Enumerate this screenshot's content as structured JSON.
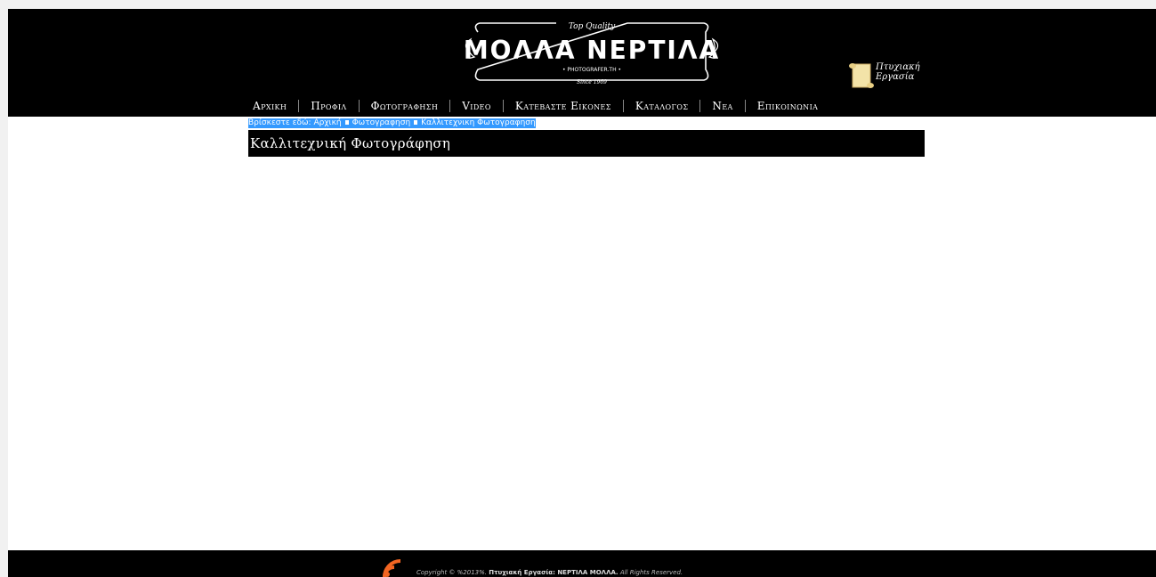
{
  "logo": {
    "top_line": "Top Quality",
    "name": "ΜΟΛΛΑ ΝΕΡΤΙΛΑ",
    "subtitle": "• PHOTOGRAFER.TH •",
    "since": "Since 1969"
  },
  "thesis": {
    "line1": "Πτυχιακή",
    "line2": "Εργασία"
  },
  "nav": [
    "Αρχικη",
    "Προφιλ",
    "Φωτογραφηση",
    "Video",
    "Κατεβαστε Εικονες",
    "Καταλογος",
    "Νεα",
    "Επικοινωνια"
  ],
  "breadcrumb": {
    "prefix": "Βρίσκεστε εδώ:",
    "items": [
      "Αρχική",
      "Φωτογραφηση",
      "Καλλιτεχνικη Φωτογραφηση"
    ]
  },
  "page_title": "Καλλιτεχνική Φωτογράφηση",
  "footer": {
    "copyright_prefix": "Copyright © %2013%.",
    "owner": "Πτυχιακή Εργασία: ΝΕΡΤΙΛΑ ΜΟΛΛΑ.",
    "rights": "All Rights Reserved."
  },
  "colors": {
    "header_bg": "#000000",
    "breadcrumb_highlight": "#3399ff",
    "rss": "#f26522"
  },
  "icons": [
    "logo-frame",
    "scroll-icon",
    "rss-icon"
  ]
}
